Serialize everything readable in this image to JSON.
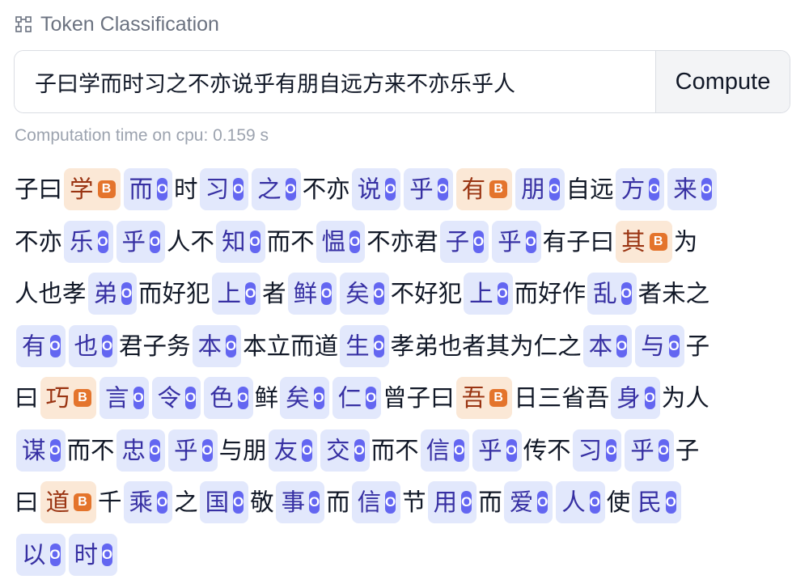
{
  "header": {
    "title": "Token Classification",
    "icon": "token-classification-icon"
  },
  "input": {
    "value": "子曰学而时习之不亦说乎有朋自远方来不亦乐乎人"
  },
  "compute_label": "Compute",
  "timing": "Computation time on cpu: 0.159 s",
  "colors": {
    "O_bg": "#e2e8fc",
    "O_badge": "#6366f1",
    "B_bg": "#fbe8d6",
    "B_badge": "#e4742c"
  },
  "lines": [
    [
      {
        "t": "子曰"
      },
      {
        "t": "学",
        "l": "B"
      },
      {
        "t": "而",
        "l": "O"
      },
      {
        "t": "时"
      },
      {
        "t": "习",
        "l": "O"
      },
      {
        "t": "之",
        "l": "O"
      },
      {
        "t": "不亦"
      },
      {
        "t": "说",
        "l": "O"
      },
      {
        "t": "乎",
        "l": "O"
      },
      {
        "t": "有",
        "l": "B"
      },
      {
        "t": "朋",
        "l": "O"
      },
      {
        "t": "自远"
      },
      {
        "t": "方",
        "l": "O"
      },
      {
        "t": "来",
        "l": "O"
      }
    ],
    [
      {
        "t": "不亦"
      },
      {
        "t": "乐",
        "l": "O"
      },
      {
        "t": "乎",
        "l": "O"
      },
      {
        "t": "人不"
      },
      {
        "t": "知",
        "l": "O"
      },
      {
        "t": "而不"
      },
      {
        "t": "愠",
        "l": "O"
      },
      {
        "t": "不亦君"
      },
      {
        "t": "子",
        "l": "O"
      },
      {
        "t": "乎",
        "l": "O"
      },
      {
        "t": "有子曰"
      },
      {
        "t": "其",
        "l": "B"
      },
      {
        "t": "为"
      }
    ],
    [
      {
        "t": "人也孝"
      },
      {
        "t": "弟",
        "l": "O"
      },
      {
        "t": "而好犯"
      },
      {
        "t": "上",
        "l": "O"
      },
      {
        "t": "者"
      },
      {
        "t": "鲜",
        "l": "O"
      },
      {
        "t": "矣",
        "l": "O"
      },
      {
        "t": "不好犯"
      },
      {
        "t": "上",
        "l": "O"
      },
      {
        "t": "而好作"
      },
      {
        "t": "乱",
        "l": "O"
      },
      {
        "t": "者未之"
      }
    ],
    [
      {
        "t": "有",
        "l": "O"
      },
      {
        "t": "也",
        "l": "O"
      },
      {
        "t": "君子务"
      },
      {
        "t": "本",
        "l": "O"
      },
      {
        "t": "本立而道"
      },
      {
        "t": "生",
        "l": "O"
      },
      {
        "t": "孝弟也者其为仁之"
      },
      {
        "t": "本",
        "l": "O"
      },
      {
        "t": "与",
        "l": "O"
      },
      {
        "t": "子"
      }
    ],
    [
      {
        "t": "曰"
      },
      {
        "t": "巧",
        "l": "B"
      },
      {
        "t": "言",
        "l": "O"
      },
      {
        "t": "令",
        "l": "O"
      },
      {
        "t": "色",
        "l": "O"
      },
      {
        "t": "鲜"
      },
      {
        "t": "矣",
        "l": "O"
      },
      {
        "t": "仁",
        "l": "O"
      },
      {
        "t": "曾子曰"
      },
      {
        "t": "吾",
        "l": "B"
      },
      {
        "t": "日三省吾"
      },
      {
        "t": "身",
        "l": "O"
      },
      {
        "t": "为人"
      }
    ],
    [
      {
        "t": "谋",
        "l": "O"
      },
      {
        "t": "而不"
      },
      {
        "t": "忠",
        "l": "O"
      },
      {
        "t": "乎",
        "l": "O"
      },
      {
        "t": "与朋"
      },
      {
        "t": "友",
        "l": "O"
      },
      {
        "t": "交",
        "l": "O"
      },
      {
        "t": "而不"
      },
      {
        "t": "信",
        "l": "O"
      },
      {
        "t": "乎",
        "l": "O"
      },
      {
        "t": "传不"
      },
      {
        "t": "习",
        "l": "O"
      },
      {
        "t": "乎",
        "l": "O"
      },
      {
        "t": "子"
      }
    ],
    [
      {
        "t": "曰"
      },
      {
        "t": "道",
        "l": "B"
      },
      {
        "t": "千"
      },
      {
        "t": "乘",
        "l": "O"
      },
      {
        "t": "之"
      },
      {
        "t": "国",
        "l": "O"
      },
      {
        "t": "敬"
      },
      {
        "t": "事",
        "l": "O"
      },
      {
        "t": "而"
      },
      {
        "t": "信",
        "l": "O"
      },
      {
        "t": "节"
      },
      {
        "t": "用",
        "l": "O"
      },
      {
        "t": "而"
      },
      {
        "t": "爱",
        "l": "O"
      },
      {
        "t": "人",
        "l": "O"
      },
      {
        "t": "使"
      },
      {
        "t": "民",
        "l": "O"
      }
    ],
    [
      {
        "t": "以",
        "l": "O"
      },
      {
        "t": "时",
        "l": "O"
      }
    ]
  ]
}
